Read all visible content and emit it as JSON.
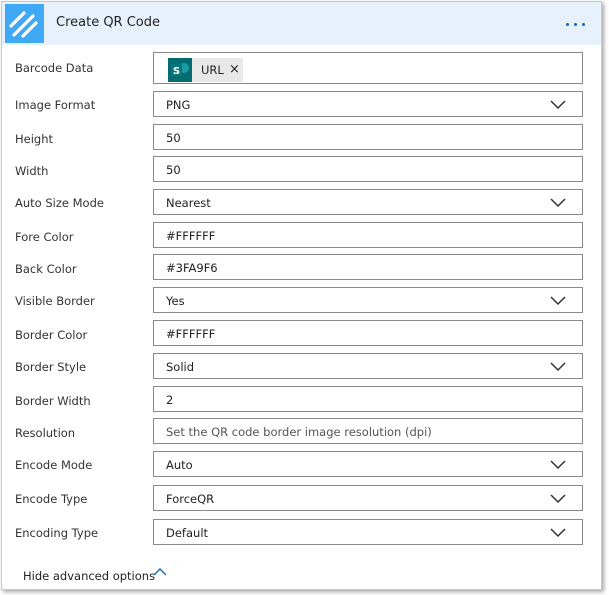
{
  "card": {
    "title": "Create QR Code",
    "accent_color": "#3FA9F6",
    "more_icon": "ellipsis-icon"
  },
  "fields": [
    {
      "label": "Barcode Data",
      "type": "token",
      "token_label": "URL",
      "token_icon": "sharepoint-icon",
      "remove_glyph": "×"
    },
    {
      "label": "Image Format",
      "type": "select",
      "value": "PNG"
    },
    {
      "label": "Height",
      "type": "text",
      "value": "50"
    },
    {
      "label": "Width",
      "type": "text",
      "value": "50"
    },
    {
      "label": "Auto Size Mode",
      "type": "select",
      "value": "Nearest"
    },
    {
      "label": "Fore Color",
      "type": "text",
      "value": "#FFFFFF"
    },
    {
      "label": "Back Color",
      "type": "text",
      "value": "#3FA9F6"
    },
    {
      "label": "Visible Border",
      "type": "select",
      "value": "Yes"
    },
    {
      "label": "Border Color",
      "type": "text",
      "value": "#FFFFFF"
    },
    {
      "label": "Border Style",
      "type": "select",
      "value": "Solid"
    },
    {
      "label": "Border Width",
      "type": "text",
      "value": "2"
    },
    {
      "label": "Resolution",
      "type": "text",
      "value": "",
      "placeholder": "Set the QR code border image resolution (dpi)"
    },
    {
      "label": "Encode Mode",
      "type": "select",
      "value": "Auto"
    },
    {
      "label": "Encode Type",
      "type": "select",
      "value": "ForceQR"
    },
    {
      "label": "Encoding Type",
      "type": "select",
      "value": "Default"
    }
  ],
  "footer": {
    "toggle_label": "Hide advanced options",
    "toggle_icon": "chevron-up-icon"
  }
}
